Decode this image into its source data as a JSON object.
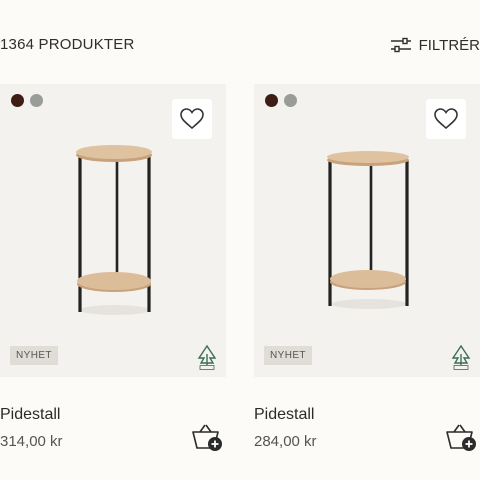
{
  "header": {
    "product_count": "1364 PRODUKTER",
    "filter_label": "FILTRÉR"
  },
  "products": [
    {
      "name": "Pidestall",
      "price": "314,00 kr",
      "badge": "NYHET",
      "swatches": [
        "#3d1d14",
        "#9a9c98"
      ],
      "wishlist_icon": "heart-icon",
      "cart_icon": "add-to-basket-icon",
      "certification_icon": "fsc-tree-icon"
    },
    {
      "name": "Pidestall",
      "price": "284,00 kr",
      "badge": "NYHET",
      "swatches": [
        "#3d1d14",
        "#9a9c98"
      ],
      "wishlist_icon": "heart-icon",
      "cart_icon": "add-to-basket-icon",
      "certification_icon": "fsc-tree-icon"
    }
  ],
  "colors": {
    "background": "#fcfbf7",
    "card_background": "#f4f2ee",
    "wood": "#d9b892",
    "metal": "#222222"
  }
}
